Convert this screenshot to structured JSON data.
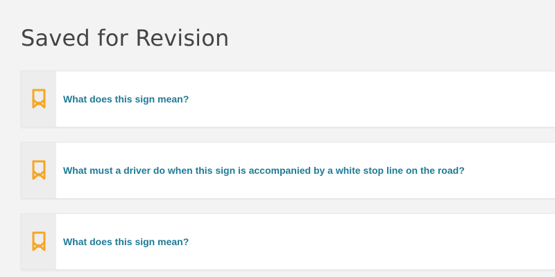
{
  "page": {
    "title": "Saved for Revision"
  },
  "saved_items": [
    {
      "question": "What does this sign mean?",
      "icon": "bookmark-icon"
    },
    {
      "question": "What must a driver do when this sign is accompanied by a white stop line on the road?",
      "icon": "bookmark-icon"
    },
    {
      "question": "What does this sign mean?",
      "icon": "bookmark-icon"
    }
  ],
  "colors": {
    "accent": "#f5a623",
    "link": "#1e7a96",
    "title": "#444444"
  }
}
